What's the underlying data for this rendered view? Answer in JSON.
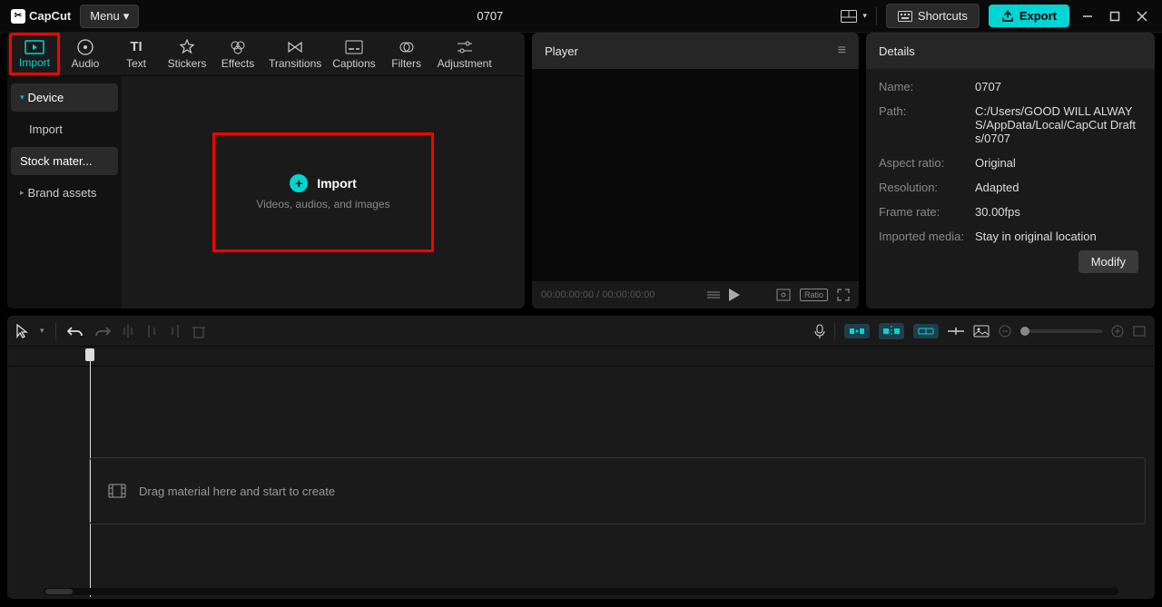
{
  "app": {
    "name": "CapCut",
    "menu_label": "Menu"
  },
  "project": {
    "title": "0707"
  },
  "topbar": {
    "shortcuts_label": "Shortcuts",
    "export_label": "Export"
  },
  "categories": [
    {
      "id": "import",
      "label": "Import"
    },
    {
      "id": "audio",
      "label": "Audio"
    },
    {
      "id": "text",
      "label": "Text"
    },
    {
      "id": "stickers",
      "label": "Stickers"
    },
    {
      "id": "effects",
      "label": "Effects"
    },
    {
      "id": "transitions",
      "label": "Transitions"
    },
    {
      "id": "captions",
      "label": "Captions"
    },
    {
      "id": "filters",
      "label": "Filters"
    },
    {
      "id": "adjustment",
      "label": "Adjustment"
    }
  ],
  "media_sidebar": {
    "items": [
      {
        "label": "Device",
        "active": true,
        "expandable": true
      },
      {
        "label": "Import",
        "active": false
      },
      {
        "label": "Stock mater...",
        "active": true
      },
      {
        "label": "Brand assets",
        "active": false,
        "expandable": true
      }
    ]
  },
  "import_box": {
    "title": "Import",
    "subtitle": "Videos, audios, and images"
  },
  "player": {
    "header": "Player",
    "current_time": "00:00:00:00",
    "total_time": "00:00:00:00",
    "ratio_label": "Ratio"
  },
  "details": {
    "header": "Details",
    "rows": {
      "name": {
        "label": "Name:",
        "value": "0707"
      },
      "path": {
        "label": "Path:",
        "value": "C:/Users/GOOD WILL ALWAYS/AppData/Local/CapCut Drafts/0707"
      },
      "aspect": {
        "label": "Aspect ratio:",
        "value": "Original"
      },
      "resolution": {
        "label": "Resolution:",
        "value": "Adapted"
      },
      "framerate": {
        "label": "Frame rate:",
        "value": "30.00fps"
      },
      "imported": {
        "label": "Imported media:",
        "value": "Stay in original location"
      }
    },
    "modify_label": "Modify"
  },
  "timeline": {
    "drop_hint": "Drag material here and start to create"
  }
}
